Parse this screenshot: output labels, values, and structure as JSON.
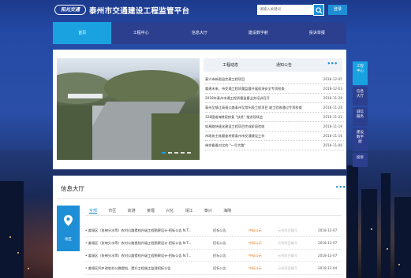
{
  "header": {
    "logo_text": "阳光交通",
    "title": "泰州市交通建设工程监管平台",
    "search_placeholder": "请输入关键词",
    "login_label": "登录"
  },
  "nav": {
    "items": [
      {
        "label": "首页",
        "active": true
      },
      {
        "label": "工程中心",
        "active": false
      },
      {
        "label": "信息大厅",
        "active": false
      },
      {
        "label": "建设数字舱",
        "active": false
      },
      {
        "label": "投诉举报",
        "active": false
      }
    ]
  },
  "news": {
    "tabs": [
      {
        "label": "工程动态",
        "active": true
      },
      {
        "label": "通知公告",
        "active": false
      }
    ],
    "more": "•••",
    "items": [
      {
        "title": "泰兴市新图县交建工程项目",
        "date": "2018-12-05"
      },
      {
        "title": "重建未来，市交通工程质量监督开展现场安全专项检查",
        "date": "2018-12-03"
      },
      {
        "title": "2018年泰州市通工程质量监督业务培训召开",
        "date": "2018-11-28"
      },
      {
        "title": "泰州至镇江高速公路泰州至常州段工程项目 竣工验收通过专项检查",
        "date": "2018-11-28"
      },
      {
        "title": "328国道海陵段修复 \"扶贫\" 推进现场会",
        "date": "2018-11-22"
      },
      {
        "title": "如皋路快速化建设工程项目完成阶段验收",
        "date": "2018-11-19"
      },
      {
        "title": "市政协主席督查考察泰州市交通建设工作",
        "date": "2018-11-16"
      },
      {
        "title": "带你看看对比的 \"一号大路\"",
        "date": "2018-11-06"
      }
    ]
  },
  "side_menu": {
    "items": [
      {
        "label": "工程\n中心",
        "active": true
      },
      {
        "label": "信息\n大厅",
        "active": false
      },
      {
        "label": "诚信\n服务",
        "active": false
      },
      {
        "label": "建设\n数字\n舱",
        "active": false
      },
      {
        "label": "投诉",
        "active": false
      }
    ]
  },
  "hall": {
    "title": "信息大厅",
    "more": "•••",
    "side_label": "地区",
    "districts": [
      {
        "label": "全部",
        "active": true
      },
      {
        "label": "市区",
        "active": false
      },
      {
        "label": "高港",
        "active": false
      },
      {
        "label": "姜堰",
        "active": false
      },
      {
        "label": "兴化",
        "active": false
      },
      {
        "label": "靖江",
        "active": false
      },
      {
        "label": "泰兴",
        "active": false
      },
      {
        "label": "海陵",
        "active": false
      }
    ],
    "rows": [
      {
        "title": "• 姜堰区（张甸分水等）农村公路提档升级工程勘察设计-招标公告 N.T...",
        "type": "招标公告",
        "status": "中标公示",
        "extra": "示例项目编号",
        "date": "2018-12-07"
      },
      {
        "title": "• 姜堰区（张甸分水等）农村公路提档升级工程勘察设计-招标公告 N.T...",
        "type": "招标公告",
        "status": "中标公示",
        "extra": "示例项目编号",
        "date": "2018-12-07"
      },
      {
        "title": "• 姜堰区（张甸分水等）农村公路提档升级工程勘察设计-招标公告 N.T...",
        "type": "招标公告",
        "status": "中标公示",
        "extra": "示例项目编号",
        "date": "2018-12-07"
      },
      {
        "title": "• 姜堰区四乡改农村公路提档、提升工程施工监理招标公告",
        "type": "招标公告",
        "status": "中标公示",
        "extra": "示例项目编号",
        "date": "2018-12-04"
      }
    ]
  }
}
